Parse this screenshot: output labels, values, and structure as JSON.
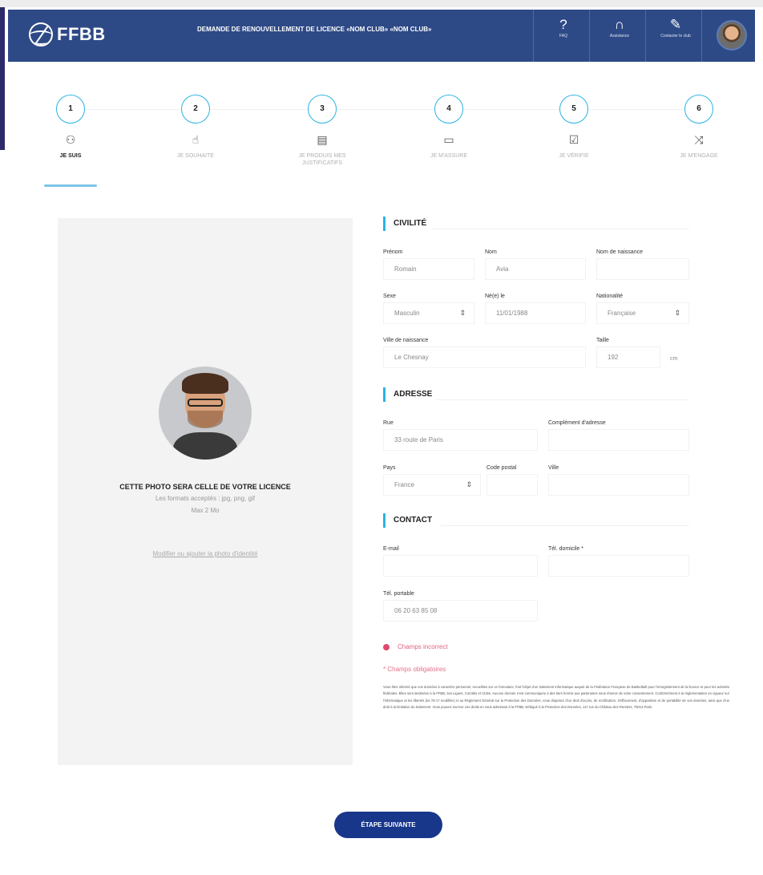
{
  "header": {
    "logo_text": "FFBB",
    "title": "DEMANDE DE RENOUVELLEMENT DE LICENCE «NOM CLUB» «NOM CLUB»",
    "buttons": [
      {
        "icon": "question-icon",
        "label": "FAQ"
      },
      {
        "icon": "headset-icon",
        "label": "Assistance"
      },
      {
        "icon": "edit-icon",
        "label": "Contacter le club"
      }
    ]
  },
  "stepper": {
    "steps": [
      {
        "number": "1",
        "label": "JE SUIS",
        "icon": "user-add-icon",
        "glyph": "⚇",
        "active": true
      },
      {
        "number": "2",
        "label": "JE SOUHAITE",
        "icon": "thumbs-up-icon",
        "glyph": "☝",
        "active": false
      },
      {
        "number": "3",
        "label": "JE PRODUIS MES JUSTIFICATIFS",
        "icon": "document-icon",
        "glyph": "▤",
        "active": false
      },
      {
        "number": "4",
        "label": "JE M'ASSURE",
        "icon": "device-icon",
        "glyph": "▭",
        "active": false
      },
      {
        "number": "5",
        "label": "JE VÉRIFIE",
        "icon": "checkbox-edit-icon",
        "glyph": "☑",
        "active": false
      },
      {
        "number": "6",
        "label": "JE M'ENGAGE",
        "icon": "shuffle-icon",
        "glyph": "⤨",
        "active": false
      }
    ]
  },
  "photo_panel": {
    "caption": "CETTE PHOTO SERA CELLE DE VOTRE LICENCE",
    "formats": "Les formats acceptés : jpg, png, gif",
    "max": "Max 2 Mo",
    "link": "Modifier ou ajouter la photo d'identité"
  },
  "civilite": {
    "title": "CIVILITÉ",
    "prenom": {
      "label": "Prénom",
      "value": "Romain"
    },
    "nom": {
      "label": "Nom",
      "value": "Avia"
    },
    "nom_naissance": {
      "label": "Nom de naissance",
      "value": ""
    },
    "sexe": {
      "label": "Sexe",
      "value": "Masculin"
    },
    "ne_le": {
      "label": "Né(e) le",
      "value": "11/01/1988"
    },
    "nationalite": {
      "label": "Nationalité",
      "value": "Française"
    },
    "ville_naissance": {
      "label": "Ville de naissance",
      "value": "Le Chesnay"
    },
    "taille": {
      "label": "Taille",
      "value": "192",
      "unit": "cm"
    }
  },
  "adresse": {
    "title": "ADRESSE",
    "rue": {
      "label": "Rue",
      "value": "33 route de Paris"
    },
    "complement": {
      "label": "Complément d'adresse",
      "value": ""
    },
    "pays": {
      "label": "Pays",
      "value": "France"
    },
    "code_postal": {
      "label": "Code postal",
      "value": ""
    },
    "ville": {
      "label": "Ville",
      "value": ""
    }
  },
  "contact": {
    "title": "CONTACT",
    "email": {
      "label": "E-mail",
      "value": ""
    },
    "tel_domicile": {
      "label": "Tél. domicile *",
      "value": ""
    },
    "tel_portable": {
      "label": "Tél. portable",
      "value": "06 20 63 85 08"
    }
  },
  "messages": {
    "error": "Champs incorrect",
    "required": "* Champs obligatoires",
    "legal": "Vous êtes informé que vos données à caractère personnel, recueillies sur ce formulaire, font l'objet d'un traitement informatique auquel de la Fédération Française de Basketball pour l'enregistrement de la licence et pour les activités fédérales. Elles sont destinées à la FFBB, ses Ligues, Comités et Clubs. Aucune donnée n'est communiquée à des tiers hormis aux partenaires sous réserve de votre consentement. Conformément à la réglementation en vigueur sur l'informatique et les libertés (loi 78-17 modifiée) et au Règlement Général sur la Protection des Données, vous disposez d'un droit d'accès, de rectification, d'effacement, d'opposition et de portabilité de vos données, ainsi que d'un droit à la limitation du traitement. Vous pouvez exercer ces droits en vous adressant à la FFBB, Délégué à la Protection des Données, 117 rue du Château des Rentiers, 75013 Paris."
  },
  "actions": {
    "next": "ÉTAPE SUIVANTE"
  },
  "colors": {
    "header_bg": "#2e4a86",
    "accent": "#29b4e2",
    "button_bg": "#18368a",
    "error": "#e04870"
  }
}
